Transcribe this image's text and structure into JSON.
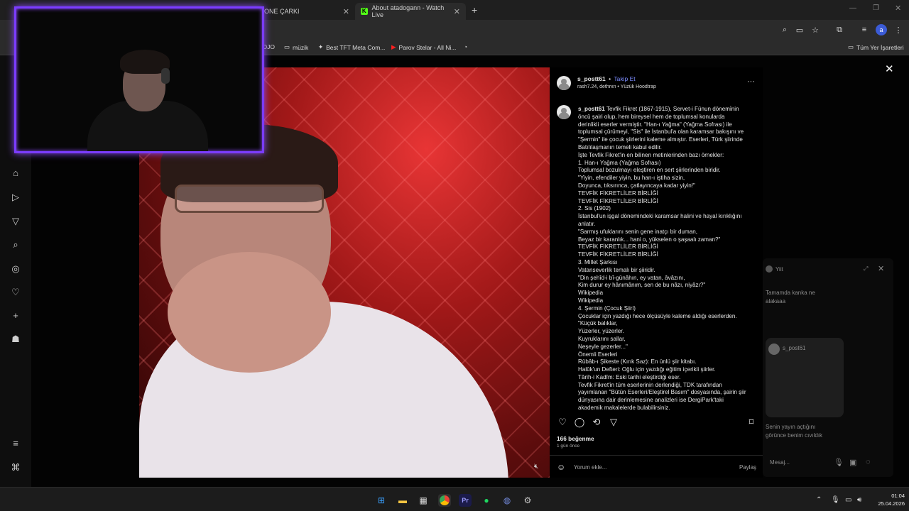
{
  "browser": {
    "tabs": [
      {
        "title": "ONE ÇARKI"
      },
      {
        "title": "About atadogann - Watch Live"
      }
    ],
    "bookmarks": [
      {
        "label": "DJO"
      },
      {
        "label": "müzik"
      },
      {
        "label": "Best TFT Meta Com..."
      },
      {
        "label": "Parov Stelar - All Ni..."
      }
    ],
    "bookmarks_right": "Tüm Yer İşaretleri",
    "profile_initial": "a"
  },
  "post": {
    "username": "s_postt61",
    "dot": "•",
    "follow_label": "Takip Et",
    "subtitle": "rash7.24, dethrxn • Yüzük Hoodtrap",
    "caption_user": "s_postt61",
    "caption_lines": [
      "Tevfik Fikret (1867-1915), Servet-i Fünun dönemi̇nin",
      "öncü şairi olup, hem bireysel hem de toplumsal konularda",
      "derinlikli eserler vermiştir. \"Han-ı Yağma\" (Yağma Sofrası) ile",
      "toplumsal çürümeyi, \"Sis\" ile İstanbul'a olan karamsar bakışını ve",
      "\"Şermin\" ile çocuk şiirlerini kaleme almıştır. Eserleri, Türk şiirinde",
      "Batılılaşmanın temeli kabul edilir.",
      "İşte Tevfik Fikret'in en bilinen metinlerinden bazı örnekler:",
      "1. Han-ı Yağma (Yağma Sofrası)",
      "Toplumsal bozulmayı eleştiren en sert şiirlerinden biridir.",
      "\"Yiyin, efendiler yiyin, bu han-ı iştiha sizin,",
      "Doyunca, tıksırınca, çatlayıncaya kadar yiyin!\"",
      "TEVFİK FİKRETLİLER BİRLİĞİ",
      "TEVFİK FİKRETLİLER BİRLİĞİ",
      "2. Sis (1902)",
      "İstanbul'un işgal dönemindeki karamsar halini ve hayal kırıklığını",
      "anlatır.",
      "\"Sarmış ufuklarını senin gene inatçı bir duman,",
      "Beyaz bir karanlık... hani o, yükselen o şaşaalı zaman?\"",
      "TEVFİK FİKRETLİLER BİRLİĞİ",
      "TEVFİK FİKRETLİLER BİRLİĞİ",
      "3. Millet Şarkısı",
      "Vatanseverlik temalı bir şiiridir.",
      "\"Din şehîd-i bî-günâhın, ey vatan, âvâzını,",
      "Kim durur ey hânımânım, sen de bu nâzı, niyâzı?\"",
      "Wikipedia",
      "Wikipedia",
      "4. Şermin (Çocuk Şiiri)",
      "Çocuklar için yazdığı hece ölçüsüyle kaleme aldığı eserlerden.",
      "\"Küçük balıklar,",
      "Yüzerler, yüzerler.",
      "Kuyruklarını sallar,",
      "Neşeyle gezerler...\"",
      "Önemli Eserleri",
      "Rübâb-ı Şikeste (Kırık Saz): En ünlü şiir kitabı.",
      "Halûk'un Defteri: Oğlu için yazdığı eğitim içerikli şiirler.",
      "Târih-i Kadîm: Eski tarihi eleştirdiği eser.",
      "Tevfik Fikret'in tüm eserlerinin derlendiği, TDK tarafından",
      "yayımlanan \"Bütün Eserleri/Eleştirel Basım\" dosyasında, şairin şiir",
      "dünyasına dair derinlemesine analizleri ise DergiPark'taki",
      "akademik makalelerde bulabilirsiniz."
    ],
    "likes": "166 beğenme",
    "time_ago": "1 gün önce",
    "comment_placeholder": "Yorum ekle...",
    "share_label": "Paylaş"
  },
  "chat_overlay": {
    "title": "Yiit",
    "message1": "Tamamda kanka ne",
    "message1b": "alakaaa",
    "contact": "s_post61",
    "notice1": "Senin yayın açtığını",
    "notice2": "görünce benim cıvıldık",
    "input_placeholder": "Mesaj..."
  },
  "taskbar": {
    "time": "01:04",
    "date": "25.04.2026"
  }
}
